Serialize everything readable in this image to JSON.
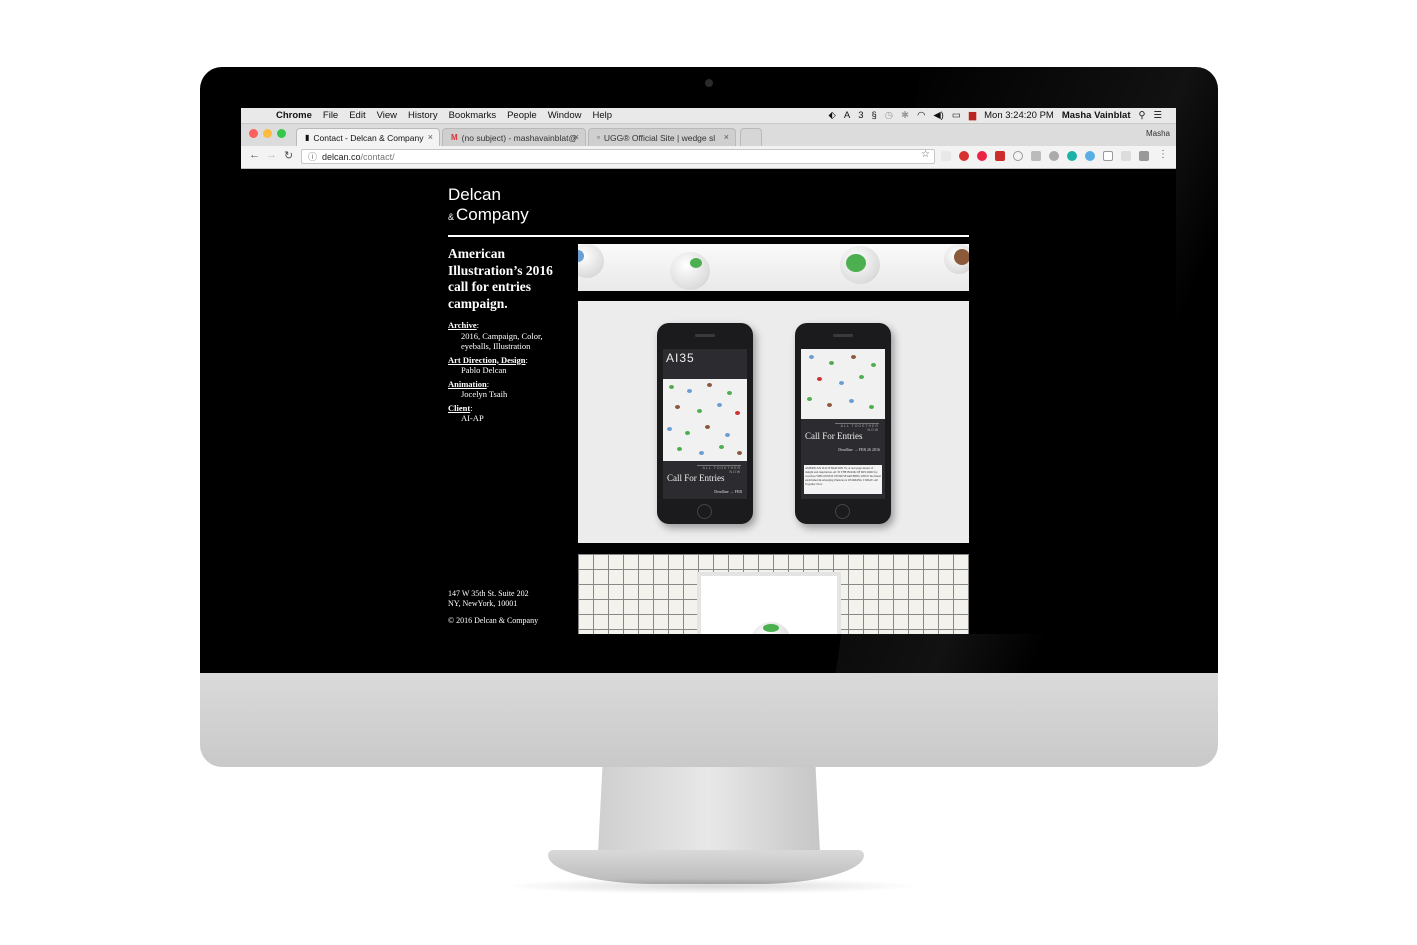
{
  "menubar": {
    "app": "Chrome",
    "items": [
      "File",
      "Edit",
      "View",
      "History",
      "Bookmarks",
      "People",
      "Window",
      "Help"
    ],
    "status_extra": "3",
    "clock": "Mon 3:24:20 PM",
    "user": "Masha Vainblat"
  },
  "tabs": [
    {
      "title": "Contact - Delcan & Company",
      "close": "×"
    },
    {
      "title": "(no subject) - mashavainblat@",
      "close": "×"
    },
    {
      "title": "UGG® Official Site | wedge sl",
      "close": "×"
    }
  ],
  "profile_name": "Masha",
  "address": {
    "host": "delcan.co",
    "path": "/contact/"
  },
  "site": {
    "logo_line1": "Delcan",
    "logo_amp": "&",
    "logo_line2": "Company",
    "headline": "American Illustration’s 2016 call for entries campaign.",
    "credits": [
      {
        "label": "Archive",
        "value": "2016, Campaign, Color, eyeballs, Illustration"
      },
      {
        "label": "Art Direction, Design",
        "value": "Pablo Delcan"
      },
      {
        "label": "Animation",
        "value": "Jocelyn Tsaih"
      },
      {
        "label": "Client",
        "value": "AI-AP"
      }
    ],
    "address_line1": "147 W 35th St. Suite 202",
    "address_line2": "NY, NewYork, 10001",
    "copyright": "© 2016 Delcan & Company"
  },
  "phone_screens": {
    "ai35": "AI35",
    "all_together": "ALL TOGETHER NOW",
    "call_for_entries": "Call For Entries",
    "deadline_left": "Deadline → FEB",
    "deadline_right": "Deadline → FEB 26 2016",
    "blurb": "AMERICAN ILLUSTRATION 35. A real page-turner of insight and inspiration. AI 35 THE BOOK OF RECORD for creatives WHO INSIST ON RESEARCHING ONLY the finest established & emerging illustrators WORKING TODAY. All Together Now."
  },
  "colors": {
    "page_bg": "#000000",
    "eye_green": "#4caf50",
    "eye_blue": "#6a9fd4",
    "eye_brown": "#8a5a3b"
  }
}
